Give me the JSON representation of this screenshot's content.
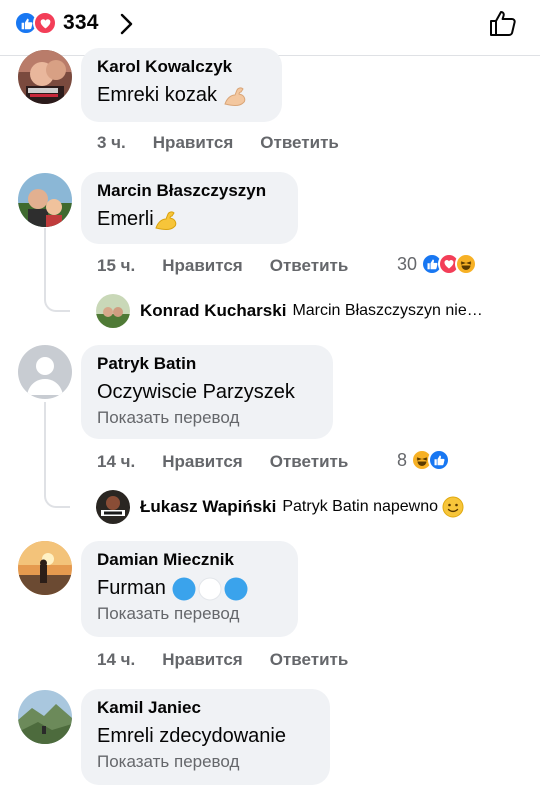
{
  "header": {
    "reaction_count": "334",
    "reaction_icons": [
      "like-icon",
      "love-icon"
    ]
  },
  "comments": [
    {
      "author": "Karol Kowalczyk",
      "text": "Emreki kozak",
      "emoji": "flexed-biceps-light",
      "time": "3 ч.",
      "like_label": "Нравится",
      "reply_label": "Ответить"
    },
    {
      "author": "Marcin Błaszczyszyn",
      "text": "Emerli",
      "emoji": "flexed-biceps",
      "time": "15 ч.",
      "like_label": "Нравится",
      "reply_label": "Ответить",
      "reaction_count": "30",
      "reaction_icons": [
        "like-icon",
        "love-icon",
        "haha-icon"
      ],
      "reply": {
        "author": "Konrad Kucharski",
        "text": "Marcin Błaszczyszyn nie…"
      }
    },
    {
      "author": "Patryk Batin",
      "text": "Oczywiscie Parzyszek",
      "translate_label": "Показать перевод",
      "time": "14 ч.",
      "like_label": "Нравится",
      "reply_label": "Ответить",
      "reaction_count": "8",
      "reaction_icons": [
        "haha-icon",
        "like-icon"
      ],
      "reply": {
        "author": "Łukasz Wapiński",
        "text": "Patryk Batin napewno",
        "emoji": "slightly-smiling-face"
      }
    },
    {
      "author": "Damian Miecznik",
      "text": "Furman",
      "emoji": "blue-white-blue-circles",
      "translate_label": "Показать перевод",
      "time": "14 ч.",
      "like_label": "Нравится",
      "reply_label": "Ответить"
    },
    {
      "author": "Kamil Janiec",
      "text": "Emreli zdecydowanie",
      "translate_label": "Показать перевод"
    }
  ],
  "colors": {
    "bubble": "#f0f2f5",
    "secondary_text": "#65676b",
    "like_blue": "#1877f2",
    "love_red": "#f33e58",
    "haha_yellow": "#f7b125"
  }
}
